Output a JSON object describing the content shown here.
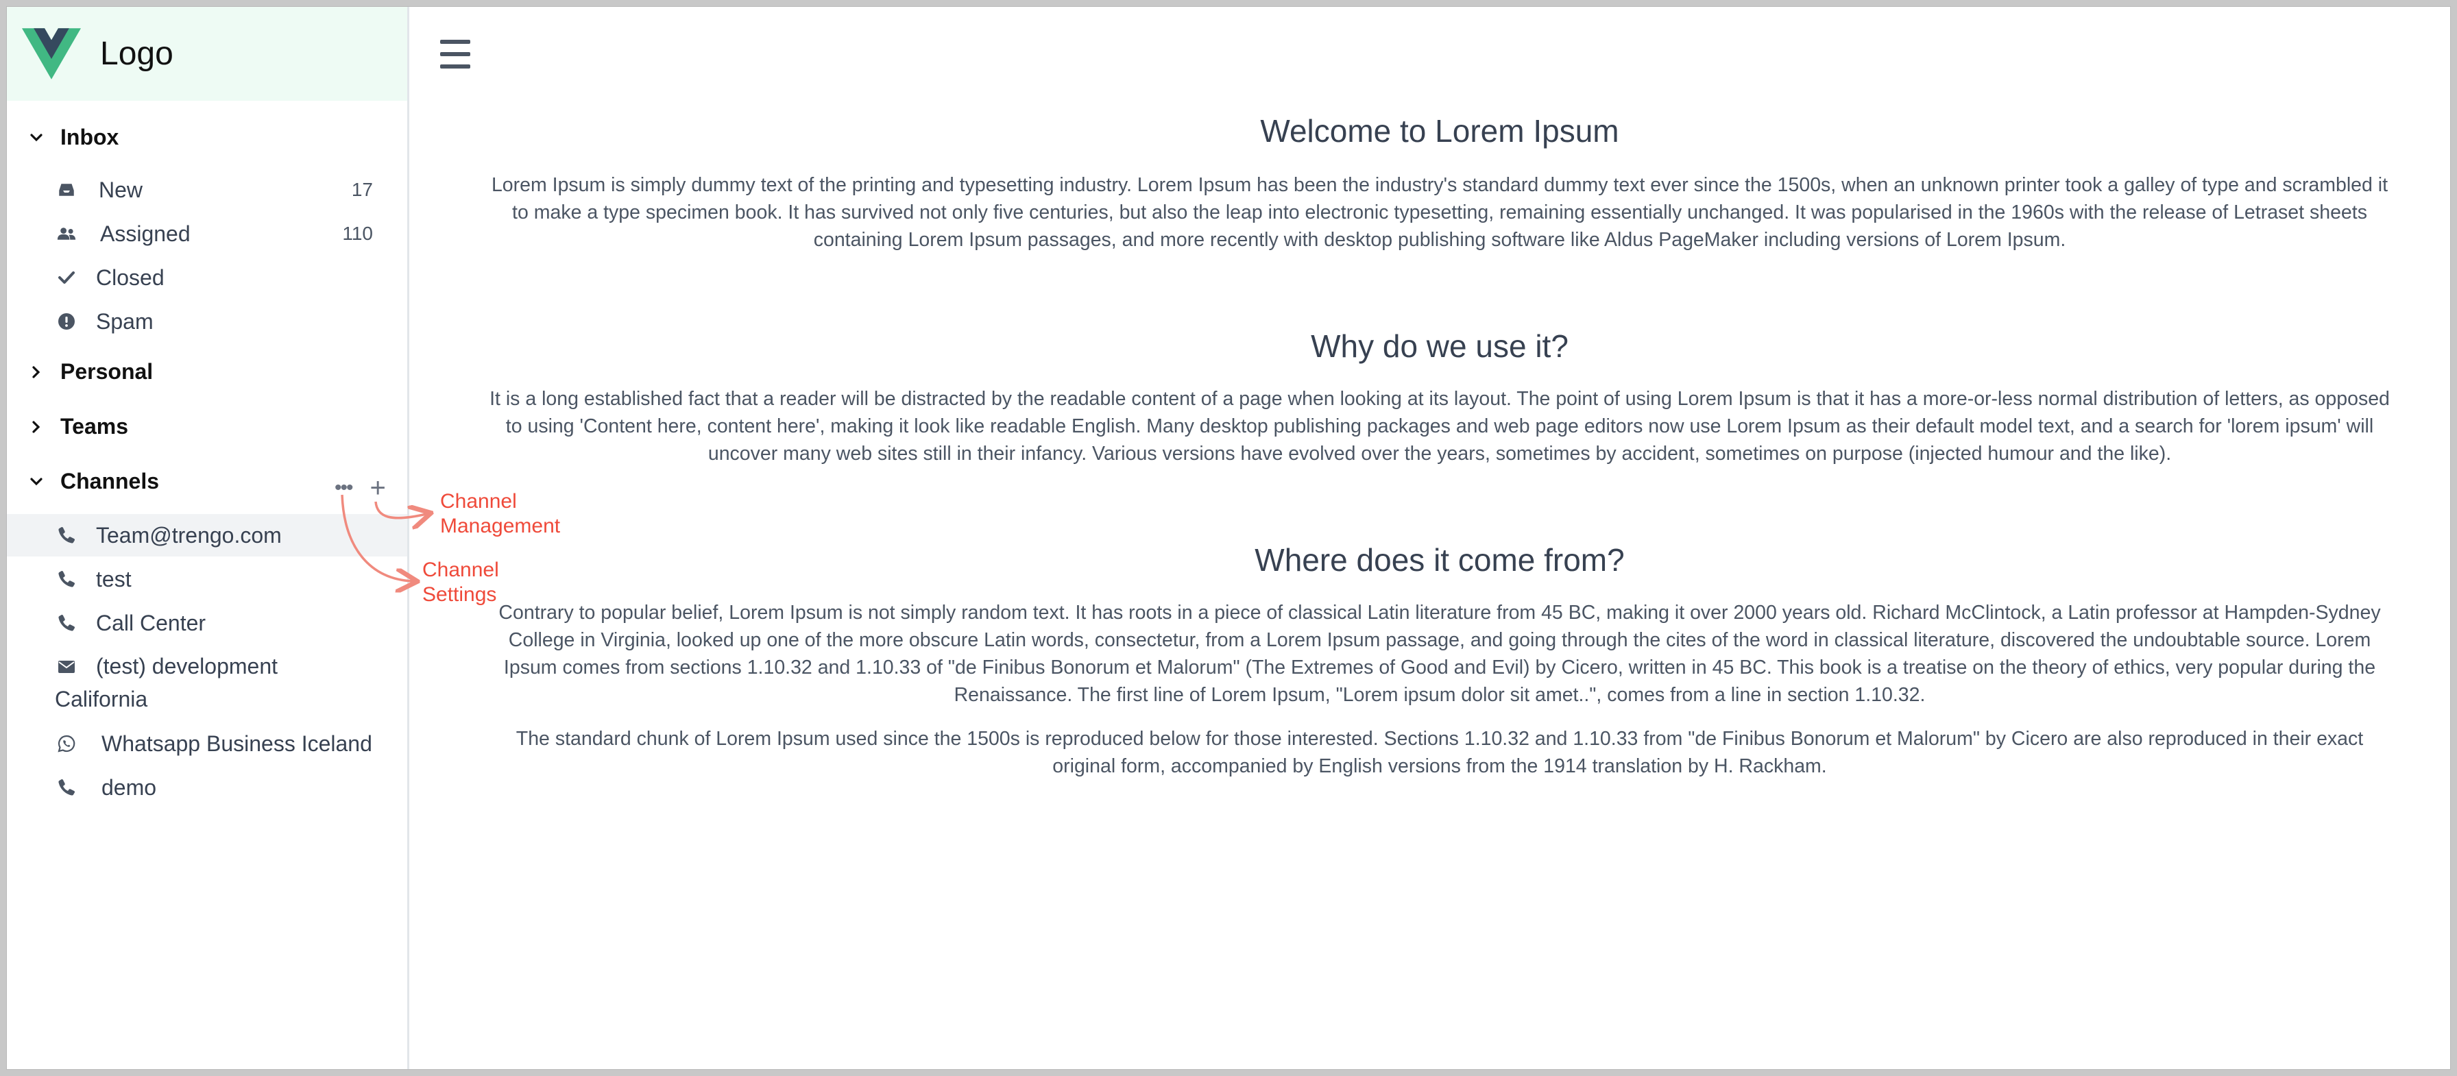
{
  "logo": {
    "text": "Logo"
  },
  "sidebar": {
    "inbox": {
      "title": "Inbox",
      "items": [
        {
          "label": "New",
          "count": "17"
        },
        {
          "label": "Assigned",
          "count": "110"
        },
        {
          "label": "Closed"
        },
        {
          "label": "Spam"
        }
      ]
    },
    "personal": {
      "title": "Personal"
    },
    "teams": {
      "title": "Teams"
    },
    "channels": {
      "title": "Channels",
      "more_icon": "ellipsis-icon",
      "add_icon": "plus-icon",
      "items": [
        {
          "label": "Team@trengo.com",
          "icon": "phone-icon"
        },
        {
          "label": "test",
          "icon": "phone-icon"
        },
        {
          "label": "Call Center",
          "icon": "phone-icon"
        },
        {
          "label_line1": "(test) development",
          "label_line2": "California",
          "icon": "envelope-icon"
        },
        {
          "label": "Whatsapp Business Iceland",
          "icon": "whatsapp-icon"
        },
        {
          "label": "demo",
          "icon": "phone-icon"
        }
      ]
    }
  },
  "annotations": {
    "management": {
      "line1": "Channel",
      "line2": "Management"
    },
    "settings": {
      "line1": "Channel",
      "line2": "Settings"
    }
  },
  "content": {
    "heading1": "Welcome to Lorem Ipsum",
    "para1": "Lorem Ipsum is simply dummy text of the printing and typesetting industry. Lorem Ipsum has been the industry's standard dummy text ever since the 1500s, when an unknown printer took a galley of type and scrambled it to make a type specimen book. It has survived not only five centuries, but also the leap into electronic typesetting, remaining essentially unchanged. It was popularised in the 1960s with the release of Letraset sheets containing Lorem Ipsum passages, and more recently with desktop publishing software like Aldus PageMaker including versions of Lorem Ipsum.",
    "heading2": "Why do we use it?",
    "para2": "It is a long established fact that a reader will be distracted by the readable content of a page when looking at its layout. The point of using Lorem Ipsum is that it has a more-or-less normal distribution of letters, as opposed to using 'Content here, content here', making it look like readable English. Many desktop publishing packages and web page editors now use Lorem Ipsum as their default model text, and a search for 'lorem ipsum' will uncover many web sites still in their infancy. Various versions have evolved over the years, sometimes by accident, sometimes on purpose (injected humour and the like).",
    "heading3": "Where does it come from?",
    "para3": "Contrary to popular belief, Lorem Ipsum is not simply random text. It has roots in a piece of classical Latin literature from 45 BC, making it over 2000 years old. Richard McClintock, a Latin professor at Hampden-Sydney College in Virginia, looked up one of the more obscure Latin words, consectetur, from a Lorem Ipsum passage, and going through the cites of the word in classical literature, discovered the undoubtable source. Lorem Ipsum comes from sections 1.10.32 and 1.10.33 of \"de Finibus Bonorum et Malorum\" (The Extremes of Good and Evil) by Cicero, written in 45 BC. This book is a treatise on the theory of ethics, very popular during the Renaissance. The first line of Lorem Ipsum, \"Lorem ipsum dolor sit amet..\", comes from a line in section 1.10.32.",
    "para4": "The standard chunk of Lorem Ipsum used since the 1500s is reproduced below for those interested. Sections 1.10.32 and 1.10.33 from \"de Finibus Bonorum et Malorum\" by Cicero are also reproduced in their exact original form, accompanied by English versions from the 1914 translation by H. Rackham."
  },
  "colors": {
    "logo_bg": "#eefbf4",
    "vue_green": "#41b883",
    "vue_dark": "#35495e",
    "annotation": "#ef4a3a"
  }
}
